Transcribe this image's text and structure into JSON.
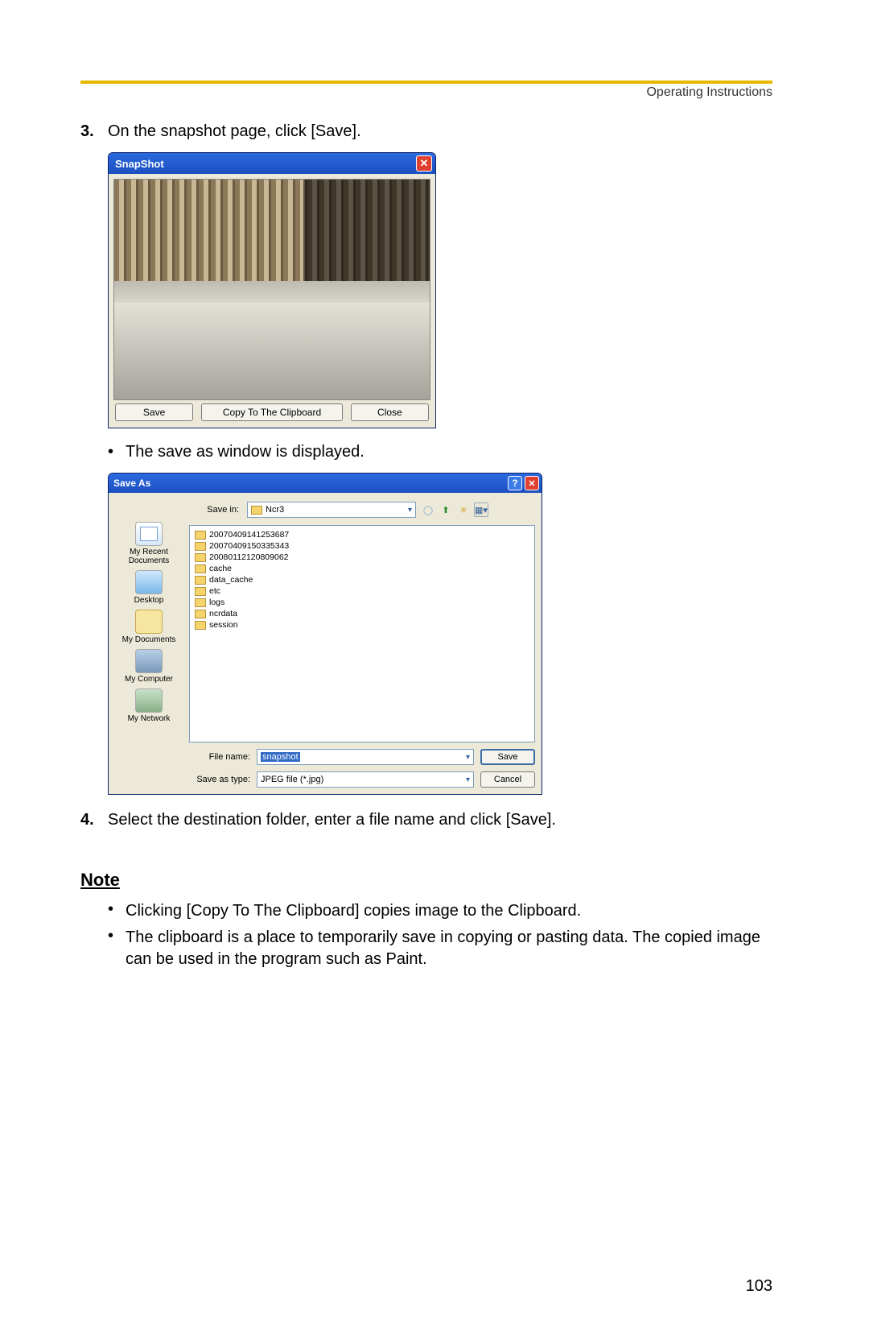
{
  "header": {
    "chapter": "Operating Instructions"
  },
  "steps": {
    "s3": {
      "num": "3.",
      "text": "On the snapshot page, click [Save]."
    },
    "bullet_save_as": "The save as window is displayed.",
    "s4": {
      "num": "4.",
      "text": "Select the destination folder, enter a file name and click [Save]."
    }
  },
  "snapshot": {
    "title": "SnapShot",
    "close_x": "✕",
    "buttons": {
      "save": "Save",
      "copy": "Copy To The Clipboard",
      "close": "Close"
    }
  },
  "saveas": {
    "title": "Save As",
    "help": "?",
    "close_x": "✕",
    "toolbar": {
      "savein_label": "Save in:",
      "folder": "Ncr3"
    },
    "sidebar": {
      "recent": "My Recent Documents",
      "desktop": "Desktop",
      "mydocs": "My Documents",
      "computer": "My Computer",
      "network": "My Network"
    },
    "files": [
      "20070409141253687",
      "20070409150335343",
      "20080112120809062",
      "cache",
      "data_cache",
      "etc",
      "logs",
      "ncrdata",
      "session"
    ],
    "filename_label": "File name:",
    "filename_value": "snapshot",
    "type_label": "Save as type:",
    "type_value": "JPEG file (*.jpg)",
    "save_btn": "Save",
    "cancel_btn": "Cancel"
  },
  "note": {
    "heading": "Note",
    "b1": "Clicking [Copy To The Clipboard] copies image to the Clipboard.",
    "b2": "The clipboard is a place to temporarily save in copying or pasting data. The copied image can be used in the program such as Paint."
  },
  "page_number": "103"
}
